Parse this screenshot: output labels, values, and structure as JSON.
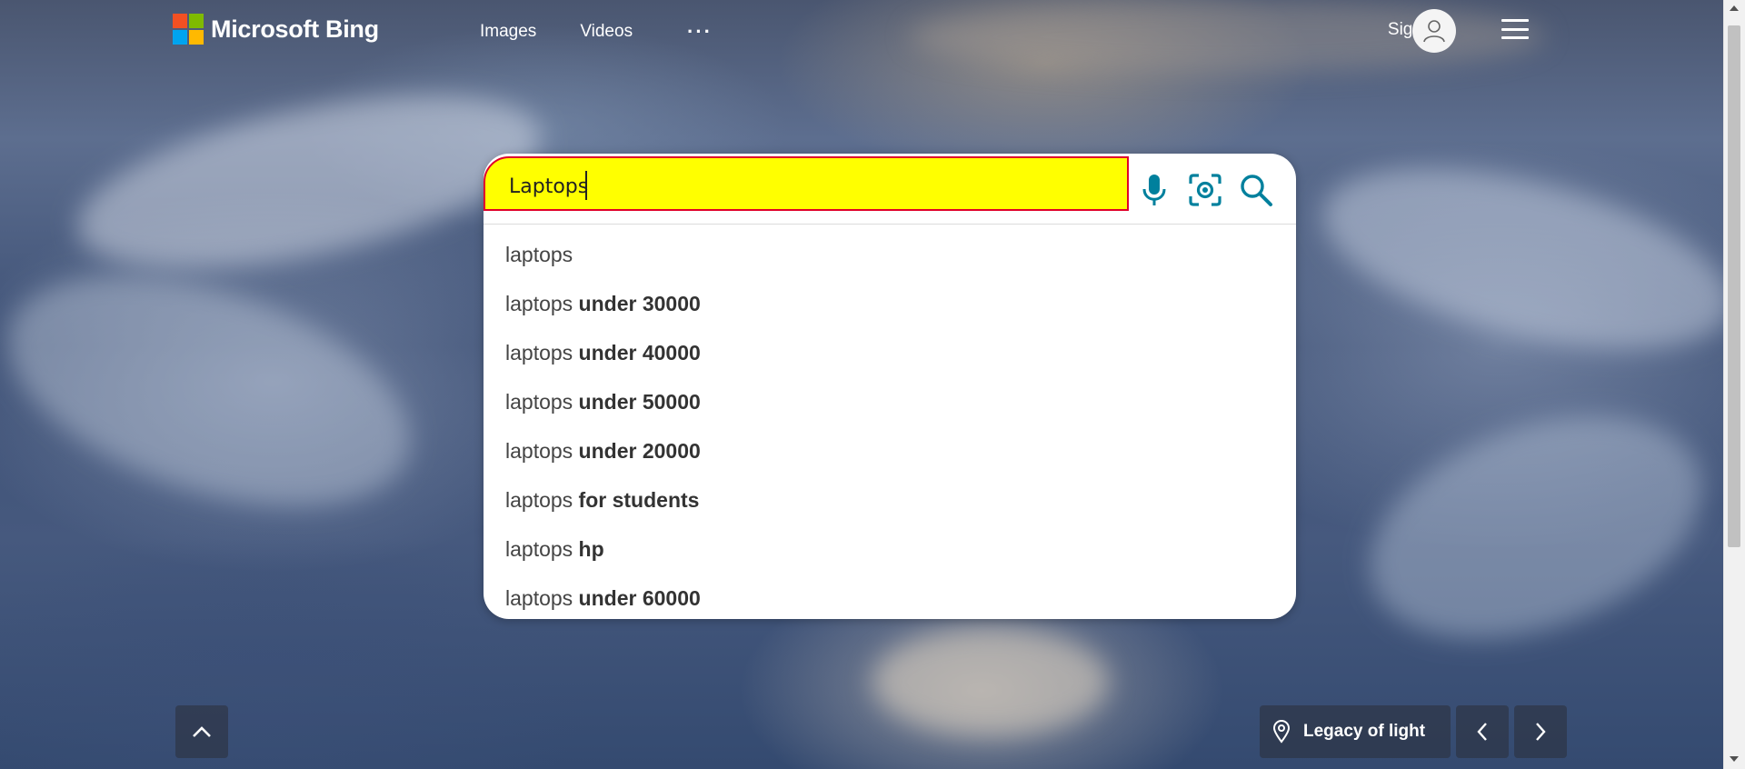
{
  "header": {
    "brand": "Microsoft Bing",
    "nav": [
      "Images",
      "Videos"
    ],
    "more": "···",
    "sign_in": "Sign in"
  },
  "search": {
    "query": "Laptops",
    "placeholder": "",
    "suggestions": [
      {
        "prefix": "laptops",
        "suffix": ""
      },
      {
        "prefix": "laptops",
        "suffix": " under 30000"
      },
      {
        "prefix": "laptops",
        "suffix": " under 40000"
      },
      {
        "prefix": "laptops",
        "suffix": " under 50000"
      },
      {
        "prefix": "laptops",
        "suffix": " under 20000"
      },
      {
        "prefix": "laptops",
        "suffix": " for students"
      },
      {
        "prefix": "laptops",
        "suffix": " hp"
      },
      {
        "prefix": "laptops",
        "suffix": " under 60000"
      }
    ]
  },
  "footer": {
    "location": "Legacy of light"
  },
  "icons": {
    "mic": "microphone-icon",
    "visual": "visual-search-icon",
    "search": "search-icon",
    "user": "user-icon",
    "menu": "hamburger-icon"
  },
  "colors": {
    "accent": "#00809d",
    "highlight": "#ffff00",
    "highlight_border": "#e0002a",
    "ms_red": "#f25022",
    "ms_green": "#7fba00",
    "ms_blue": "#00a4ef",
    "ms_yellow": "#ffb900"
  }
}
